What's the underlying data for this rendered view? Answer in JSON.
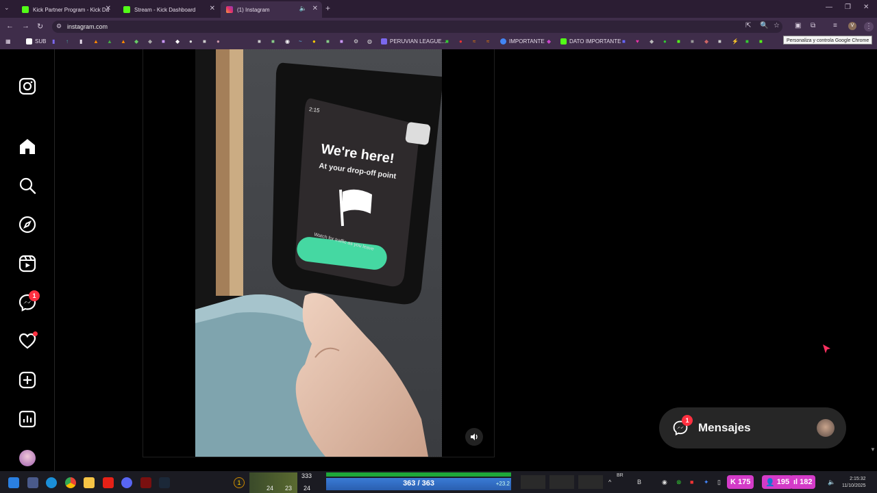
{
  "browser": {
    "tabs": [
      {
        "title": "Kick Partner Program - Kick Da",
        "active": false,
        "color": "#53fc18"
      },
      {
        "title": "Stream - Kick Dashboard",
        "active": false,
        "color": "#53fc18"
      },
      {
        "title": "(1) Instagram",
        "active": true,
        "color": "#e1306c"
      }
    ],
    "url": "instagram.com",
    "profile_initial": "V",
    "tooltip": "Personaliza y controla Google Chrome",
    "bookmarks": [
      {
        "label": "SUB",
        "color": "#ffffff"
      },
      {
        "label": "PERUVIAN LEAGUE...",
        "color": "#7b68ee"
      },
      {
        "label": "IMPORTANTE",
        "color": "#4285f4"
      },
      {
        "label": "DATO IMPORTANTE",
        "color": "#53fc18"
      }
    ]
  },
  "post": {
    "screen_time": "2:15",
    "screen_title": "We're here!",
    "screen_subtitle": "At your drop-off point",
    "screen_hint": "Watch for traffic as you leave"
  },
  "sidebar": {
    "messages_badge": "1"
  },
  "messages_panel": {
    "label": "Mensajes",
    "badge": "1"
  },
  "taskbar": {
    "hp": "363 / 363",
    "regen": "+23.2",
    "level": "1",
    "stats": [
      "24",
      "23",
      "24"
    ],
    "gold": "333",
    "counters": [
      "175",
      "195",
      "182"
    ],
    "time": "2:15:32",
    "date": "11/10/2025",
    "lang": "BR"
  },
  "colors": {
    "accent_badge": "#ff3040",
    "kick_green": "#53fc18",
    "chrome_frame": "#3f2d4a"
  }
}
